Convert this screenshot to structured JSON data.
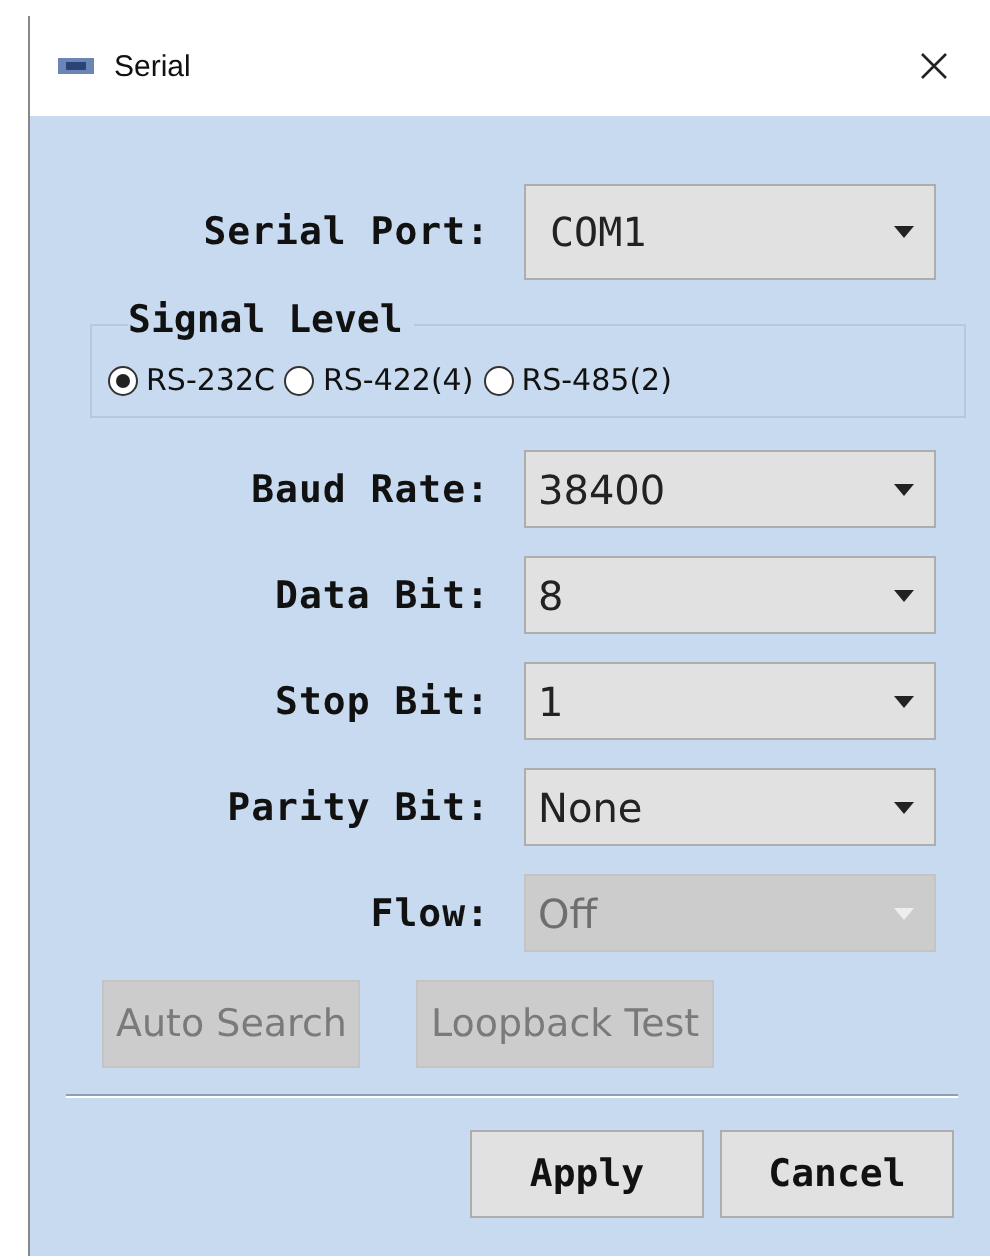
{
  "window": {
    "title": "Serial"
  },
  "serial_port": {
    "label": "Serial Port:",
    "value": "COM1",
    "disabled": false
  },
  "signal_level": {
    "title": "Signal Level",
    "options": [
      {
        "label": "RS-232C",
        "selected": true
      },
      {
        "label": "RS-422(4)",
        "selected": false
      },
      {
        "label": "RS-485(2)",
        "selected": false
      }
    ]
  },
  "settings": [
    {
      "label": "Baud Rate:",
      "value": "38400",
      "disabled": false
    },
    {
      "label": "Data Bit:",
      "value": "8",
      "disabled": false
    },
    {
      "label": "Stop Bit:",
      "value": "1",
      "disabled": false
    },
    {
      "label": "Parity Bit:",
      "value": "None",
      "disabled": false
    },
    {
      "label": "Flow:",
      "value": "Off",
      "disabled": true
    }
  ],
  "tool_buttons": [
    {
      "label": "Auto Search",
      "disabled": true
    },
    {
      "label": "Loopback Test",
      "disabled": true
    }
  ],
  "footer_buttons": [
    {
      "label": "Apply",
      "disabled": false
    },
    {
      "label": "Cancel",
      "disabled": false
    }
  ]
}
